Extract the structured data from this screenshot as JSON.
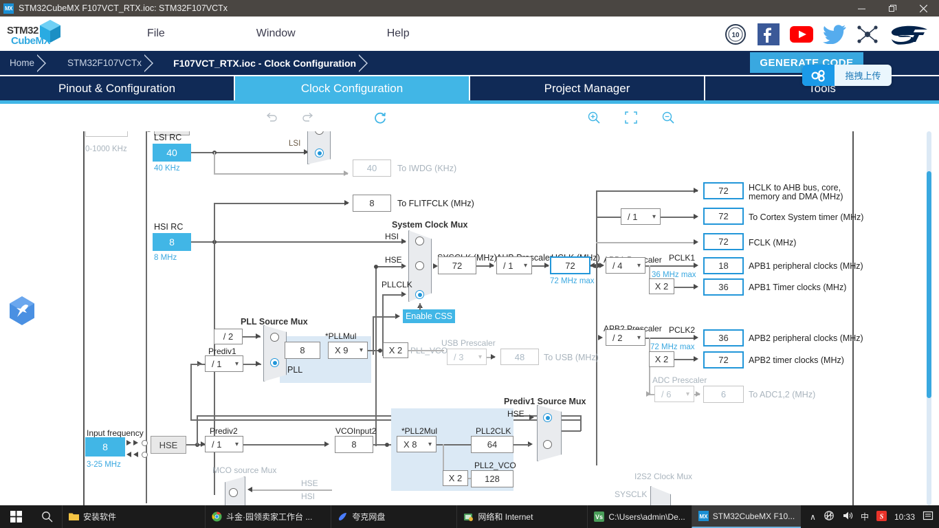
{
  "window": {
    "app_icon": "MX",
    "title": "STM32CubeMX F107VCT_RTX.ioc: STM32F107VCTx",
    "minimize": "—",
    "restore": "❐",
    "close": "✕"
  },
  "brand": {
    "line1": "STM32",
    "line2": "CubeMX"
  },
  "menu": {
    "items": [
      "File",
      "Window",
      "Help"
    ]
  },
  "social": {
    "icons": [
      "10-years-badge-icon",
      "facebook-icon",
      "youtube-icon",
      "twitter-icon",
      "network-icon",
      "st-logo-icon"
    ]
  },
  "breadcrumb": {
    "items": [
      "Home",
      "STM32F107VCTx",
      "F107VCT_RTX.ioc - Clock Configuration"
    ],
    "generate_code": "GENERATE CODE"
  },
  "upload_tooltip": {
    "label": "拖拽上传",
    "icon": "cloud-upload-icon"
  },
  "tabs": [
    {
      "label": "Pinout & Configuration",
      "active": false
    },
    {
      "label": "Clock Configuration",
      "active": true
    },
    {
      "label": "Project Manager",
      "active": false
    },
    {
      "label": "Tools",
      "active": false
    }
  ],
  "toolbar": {
    "undo": "undo-icon",
    "redo": "redo-icon",
    "refresh": "refresh-icon",
    "resolve": "Resolve Clock Issues",
    "zoom_in": "zoom-in-icon",
    "zoom_fit": "zoom-fit-icon",
    "zoom_out": "zoom-out-icon"
  },
  "diagram": {
    "lse_range": "0-1000 KHz",
    "lsi_rc_label": "LSI RC",
    "lsi_value": "40",
    "lsi_unit": "40 KHz",
    "lsi_wire_label": "LSI",
    "to_iwdg_value": "40",
    "to_iwdg_label": "To IWDG (KHz)",
    "to_flitfclk_value": "8",
    "to_flitfclk_label": "To FLITFCLK (MHz)",
    "hsi_rc_label": "HSI RC",
    "hsi_value": "8",
    "hsi_unit": "8 MHz",
    "sysclk_mux_label": "System Clock Mux",
    "mux_in_hsi": "HSI",
    "mux_in_hse": "HSE",
    "mux_in_pllclk": "PLLCLK",
    "sysclk_label": "SYSCLK (MHz)",
    "sysclk_value": "72",
    "ahb_prescaler_label": "AHB Prescaler",
    "ahb_prescaler_value": "/ 1",
    "hclk_label": "HCLK (MHz)",
    "hclk_value": "72",
    "hclk_max": "72 MHz max",
    "enable_css": "Enable CSS",
    "hclk_ahb_value": "72",
    "hclk_ahb_label": "HCLK to AHB bus, core,\nmemory and DMA (MHz)",
    "cortex_div_value": "/ 1",
    "cortex_value": "72",
    "cortex_label": "To Cortex System timer (MHz)",
    "fclk_value": "72",
    "fclk_label": "FCLK (MHz)",
    "apb1_prescaler_label": "APB1 Prescaler",
    "apb1_prescaler_value": "/ 4",
    "pclk1_label": "PCLK1",
    "pclk1_max": "36 MHz max",
    "apb1_periph_value": "18",
    "apb1_periph_label": "APB1 peripheral clocks (MHz)",
    "apb1_x2": "X 2",
    "apb1_timer_value": "36",
    "apb1_timer_label": "APB1 Timer clocks (MHz)",
    "apb2_prescaler_label": "APB2 Prescaler",
    "apb2_prescaler_value": "/ 2",
    "pclk2_label": "PCLK2",
    "pclk2_max": "72 MHz max",
    "apb2_periph_value": "36",
    "apb2_periph_label": "APB2 peripheral clocks (MHz)",
    "apb2_x2": "X 2",
    "apb2_timer_value": "72",
    "apb2_timer_label": "APB2 timer clocks (MHz)",
    "adc_prescaler_label": "ADC Prescaler",
    "adc_prescaler_value": "/ 6",
    "adc_value": "6",
    "adc_label": "To ADC1,2 (MHz)",
    "pll_source_mux_label": "PLL  Source Mux",
    "prediv1_div2": "/ 2",
    "prediv1_label": "Prediv1",
    "prediv1_value": "/ 1",
    "pll_label": "PLL",
    "pllmul_label": "*PLLMul",
    "pll_input_value": "8",
    "pllmul_value": "X 9",
    "pll_x2": "X 2",
    "pll_vco_label": "PLL_VCO",
    "usb_prescaler_label": "USB Prescaler",
    "usb_prescaler_value": "/ 3",
    "usb_value": "48",
    "usb_label": "To USB (MHz)",
    "input_frequency_label": "Input frequency",
    "input_frequency_value": "8",
    "input_frequency_range": "3-25 MHz",
    "hse_box": "HSE",
    "prediv2_label": "Prediv2",
    "prediv2_value": "/ 1",
    "vcoinput2_label": "VCOInput2",
    "vcoinput2_value": "8",
    "pll2mul_label": "*PLL2Mul",
    "pll2mul_value": "X 8",
    "pll2clk_label": "PLL2CLK",
    "pll2clk_value": "64",
    "pll2_x2": "X 2",
    "pll2_vco_label": "PLL2_VCO",
    "pll2_vco_value": "128",
    "prediv1_source_mux_label": "Prediv1 Source Mux",
    "prediv1_src_hse": "HSE",
    "mco_source_mux_label": "MCO source Mux",
    "mco_hse": "HSE",
    "mco_hsi": "HSI",
    "i2s2_clock_mux_label": "I2S2 Clock Mux",
    "i2s2_sysclk": "SYSCLK"
  },
  "taskbar": {
    "start": "start-icon",
    "search": "search-icon",
    "items": [
      {
        "label": "安装软件",
        "icon": "folder-icon",
        "active": false
      },
      {
        "label": "斗金·园领卖家工作台 ...",
        "icon": "chrome-icon",
        "active": false
      },
      {
        "label": "夸克网盘",
        "icon": "quark-icon",
        "active": false
      },
      {
        "label": "网络和 Internet",
        "icon": "network-settings-icon",
        "active": false
      },
      {
        "label": "C:\\Users\\admin\\De...",
        "icon": "vscode-icon",
        "active": false
      },
      {
        "label": "STM32CubeMX F10...",
        "icon": "mx-icon",
        "active": true
      }
    ],
    "tray": {
      "chevron": "∧",
      "network": "globe-offline-icon",
      "volume": "speaker-icon",
      "ime": "中",
      "sogou": "sogou-icon",
      "clock": "10:33",
      "notifications": "notification-icon"
    }
  },
  "colors": {
    "accent": "#41b6e6",
    "navy": "#102a56",
    "titlebar": "#4a4642",
    "taskbar": "#1b1b1b",
    "pll_bg": "#dbe9f5"
  }
}
